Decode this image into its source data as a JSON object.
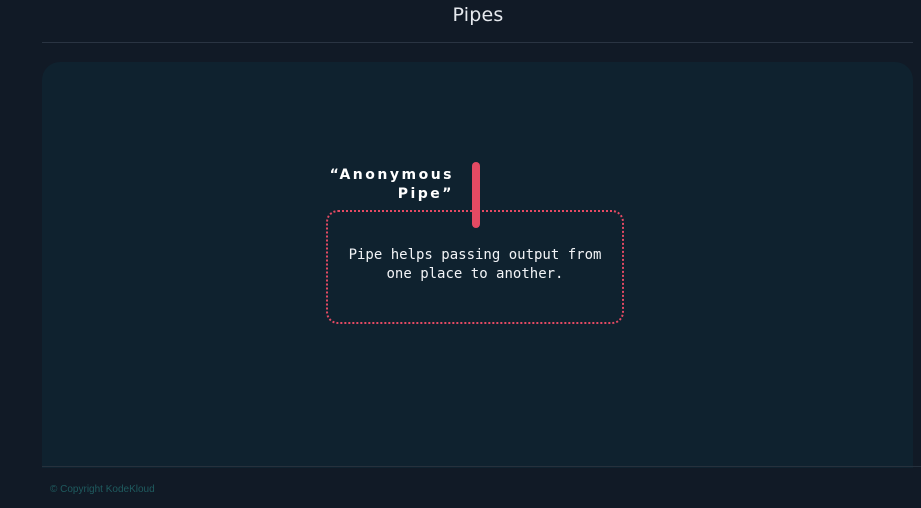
{
  "header": {
    "title": "Pipes"
  },
  "diagram": {
    "label_line1": "“Anonymous",
    "label_line2": "Pipe”",
    "description_line1": "Pipe helps passing output from",
    "description_line2": "one place to another.",
    "accent_color": "#e44a63"
  },
  "footer": {
    "copyright": "© Copyright KodeKloud"
  }
}
